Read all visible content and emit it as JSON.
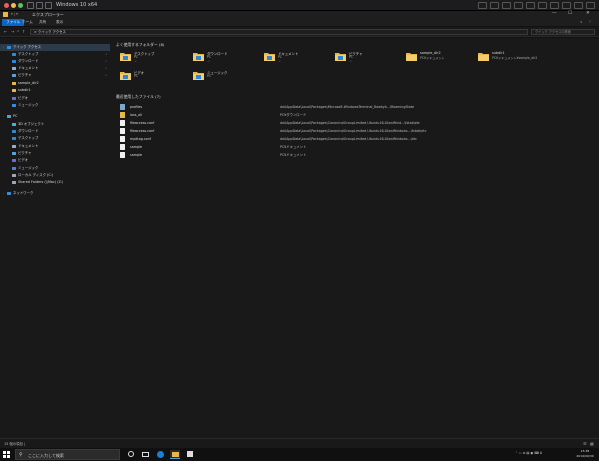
{
  "vm": {
    "title": "Windows 10 x64"
  },
  "explorer": {
    "title": "エクスプローラー",
    "window_controls": {
      "minimize": "—",
      "maximize": "☐",
      "close": "✕"
    }
  },
  "ribbon": {
    "tabs": [
      {
        "label": "ファイル",
        "active": true
      },
      {
        "label": "ホーム",
        "active": false
      },
      {
        "label": "共有",
        "active": false
      },
      {
        "label": "表示",
        "active": false
      }
    ]
  },
  "nav": {
    "back": "←",
    "forward": "→",
    "up": "↑",
    "address": "> クイック アクセス",
    "search_placeholder": "クイック アクセスの検索"
  },
  "sidebar": {
    "items": [
      {
        "label": "クイック アクセス",
        "icon": "star-icon",
        "color": "#2f8ee0",
        "pinned": false,
        "selected": true,
        "indent": 1
      },
      {
        "label": "デスクトップ",
        "icon": "desktop-icon",
        "color": "#2a8ad8",
        "pinned": true,
        "selected": false,
        "indent": 2
      },
      {
        "label": "ダウンロード",
        "icon": "download-icon",
        "color": "#2a8ad8",
        "pinned": true,
        "selected": false,
        "indent": 2
      },
      {
        "label": "ドキュメント",
        "icon": "documents-icon",
        "color": "#8fb0d0",
        "pinned": true,
        "selected": false,
        "indent": 2
      },
      {
        "label": "ピクチャ",
        "icon": "pictures-icon",
        "color": "#5aa0d8",
        "pinned": true,
        "selected": false,
        "indent": 2
      },
      {
        "label": "sample_dir2",
        "icon": "folder-icon",
        "color": "#e8b94a",
        "pinned": false,
        "selected": false,
        "indent": 2
      },
      {
        "label": "subdir1",
        "icon": "folder-icon",
        "color": "#e8b94a",
        "pinned": false,
        "selected": false,
        "indent": 2
      },
      {
        "label": "ビデオ",
        "icon": "videos-icon",
        "color": "#6a6ad8",
        "pinned": false,
        "selected": false,
        "indent": 2
      },
      {
        "label": "ミュージック",
        "icon": "music-icon",
        "color": "#3a8ad8",
        "pinned": false,
        "selected": false,
        "indent": 2
      },
      {
        "label": "PC",
        "icon": "pc-icon",
        "color": "#4aa0e0",
        "pinned": false,
        "selected": false,
        "indent": 1
      },
      {
        "label": "3D オブジェクト",
        "icon": "3d-objects-icon",
        "color": "#4ab0e0",
        "pinned": false,
        "selected": false,
        "indent": 2
      },
      {
        "label": "ダウンロード",
        "icon": "download-icon",
        "color": "#2a8ad8",
        "pinned": false,
        "selected": false,
        "indent": 2
      },
      {
        "label": "デスクトップ",
        "icon": "desktop-icon",
        "color": "#2a8ad8",
        "pinned": false,
        "selected": false,
        "indent": 2
      },
      {
        "label": "ドキュメント",
        "icon": "documents-icon",
        "color": "#8fb0d0",
        "pinned": false,
        "selected": false,
        "indent": 2
      },
      {
        "label": "ピクチャ",
        "icon": "pictures-icon",
        "color": "#5aa0d8",
        "pinned": false,
        "selected": false,
        "indent": 2
      },
      {
        "label": "ビデオ",
        "icon": "videos-icon",
        "color": "#6a6ad8",
        "pinned": false,
        "selected": false,
        "indent": 2
      },
      {
        "label": "ミュージック",
        "icon": "music-icon",
        "color": "#3a8ad8",
        "pinned": false,
        "selected": false,
        "indent": 2
      },
      {
        "label": "ローカル ディスク (C:)",
        "icon": "drive-icon",
        "color": "#9aa8b8",
        "pinned": false,
        "selected": false,
        "indent": 2
      },
      {
        "label": "Shared Folders (\\\\Mac) (Z:)",
        "icon": "network-drive-icon",
        "color": "#9aa8b8",
        "pinned": false,
        "selected": false,
        "indent": 2
      },
      {
        "label": "ネットワーク",
        "icon": "network-icon",
        "color": "#3a8ad8",
        "pinned": false,
        "selected": false,
        "indent": 1
      }
    ]
  },
  "main": {
    "frequent_header": "よく使用するフォルダー (8)",
    "frequent": [
      {
        "name": "デスクトップ",
        "sub": "PC",
        "icon": "desktop-folder-icon",
        "pinned": true
      },
      {
        "name": "ダウンロード",
        "sub": "PC",
        "icon": "download-folder-icon",
        "pinned": true
      },
      {
        "name": "ドキュメント",
        "sub": "PC",
        "icon": "documents-folder-icon",
        "pinned": true
      },
      {
        "name": "ピクチャ",
        "sub": "PC",
        "icon": "pictures-folder-icon",
        "pinned": true
      },
      {
        "name": "sample_dir2",
        "sub": "PC¥ドキュメント",
        "icon": "folder-icon",
        "pinned": false
      },
      {
        "name": "subdir1",
        "sub": "PC¥ドキュメント¥sample_dir2",
        "icon": "folder-icon",
        "pinned": false
      },
      {
        "name": "ビデオ",
        "sub": "PC",
        "icon": "videos-folder-icon",
        "pinned": false
      },
      {
        "name": "ミュージック",
        "sub": "PC",
        "icon": "music-folder-icon",
        "pinned": false
      }
    ],
    "recent_header": "最近使用したファイル (7)",
    "recent": [
      {
        "name": "profiles",
        "path": "dai\\AppData\\Local\\Packages\\Microsoft.WindowsTerminal_8wekyb...\\RoamingState",
        "icon": "json-file-icon"
      },
      {
        "name": "loxs_all",
        "path": "PC¥ダウンロード",
        "icon": "folder-file-icon"
      },
      {
        "name": "fileaccess.conf",
        "path": "dai\\AppData\\Local\\Packages\\CanonicalGroupLimited.Ubuntu16.04onWind...\\fstab\\etc",
        "icon": "file-icon"
      },
      {
        "name": "fileaccess.conf",
        "path": "dai\\AppData\\Local\\Packages\\CanonicalGroupLimited.Ubuntu16.04onWindows...\\fstab\\etc",
        "icon": "file-icon"
      },
      {
        "name": "mpdtag.conf",
        "path": "dai\\AppData\\Local\\Packages\\CanonicalGroupLimited.Ubuntu16.04onWindows...\\etc",
        "icon": "file-icon"
      },
      {
        "name": "sample",
        "path": "PC¥ドキュメント",
        "icon": "file-icon"
      },
      {
        "name": "sample",
        "path": "PC¥ドキュメント",
        "icon": "file-icon"
      }
    ]
  },
  "status": {
    "text": "15 個の項目  |"
  },
  "taskbar": {
    "search_placeholder": "ここに入力して検索",
    "time": "15:38",
    "date": "2019/09/30"
  }
}
